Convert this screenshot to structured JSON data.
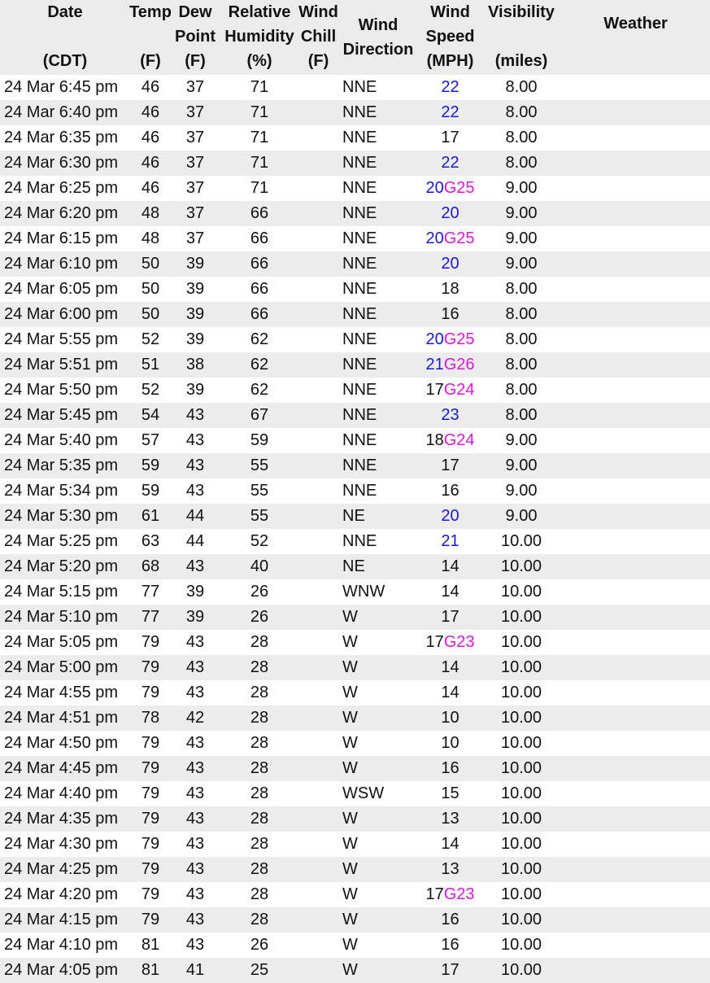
{
  "colors": {
    "sustained_high": "#1a1ad0",
    "gust": "#d61ad6",
    "header_bg": "#ebebeb",
    "row_alt_bg": "#ececec"
  },
  "headers": {
    "date": [
      "Date",
      "",
      "(CDT)"
    ],
    "temp": [
      "Temp",
      "",
      "(F)"
    ],
    "dew": [
      "Dew",
      "Point",
      "(F)"
    ],
    "rh": [
      "Relative",
      "Humidity",
      "(%)"
    ],
    "chill": [
      "Wind",
      "Chill",
      "(F)"
    ],
    "dir": [
      "Wind",
      "Direction"
    ],
    "speed": [
      "Wind",
      "Speed",
      "(MPH)"
    ],
    "vis": [
      "Visibility",
      "",
      "(miles)"
    ],
    "weather": [
      "Weather"
    ]
  },
  "rows": [
    {
      "date": "24 Mar 6:45 pm",
      "temp": "46",
      "dew": "37",
      "rh": "71",
      "chill": "",
      "dir": "NNE",
      "speed": "22",
      "speed_style": "blue",
      "gust": "",
      "vis": "8.00",
      "weather": ""
    },
    {
      "date": "24 Mar 6:40 pm",
      "temp": "46",
      "dew": "37",
      "rh": "71",
      "chill": "",
      "dir": "NNE",
      "speed": "22",
      "speed_style": "blue",
      "gust": "",
      "vis": "8.00",
      "weather": ""
    },
    {
      "date": "24 Mar 6:35 pm",
      "temp": "46",
      "dew": "37",
      "rh": "71",
      "chill": "",
      "dir": "NNE",
      "speed": "17",
      "speed_style": "blk",
      "gust": "",
      "vis": "8.00",
      "weather": ""
    },
    {
      "date": "24 Mar 6:30 pm",
      "temp": "46",
      "dew": "37",
      "rh": "71",
      "chill": "",
      "dir": "NNE",
      "speed": "22",
      "speed_style": "blue",
      "gust": "",
      "vis": "8.00",
      "weather": ""
    },
    {
      "date": "24 Mar 6:25 pm",
      "temp": "46",
      "dew": "37",
      "rh": "71",
      "chill": "",
      "dir": "NNE",
      "speed": "20",
      "speed_style": "blue",
      "gust": "G25",
      "vis": "9.00",
      "weather": ""
    },
    {
      "date": "24 Mar 6:20 pm",
      "temp": "48",
      "dew": "37",
      "rh": "66",
      "chill": "",
      "dir": "NNE",
      "speed": "20",
      "speed_style": "blue",
      "gust": "",
      "vis": "9.00",
      "weather": ""
    },
    {
      "date": "24 Mar 6:15 pm",
      "temp": "48",
      "dew": "37",
      "rh": "66",
      "chill": "",
      "dir": "NNE",
      "speed": "20",
      "speed_style": "blue",
      "gust": "G25",
      "vis": "9.00",
      "weather": ""
    },
    {
      "date": "24 Mar 6:10 pm",
      "temp": "50",
      "dew": "39",
      "rh": "66",
      "chill": "",
      "dir": "NNE",
      "speed": "20",
      "speed_style": "blue",
      "gust": "",
      "vis": "9.00",
      "weather": ""
    },
    {
      "date": "24 Mar 6:05 pm",
      "temp": "50",
      "dew": "39",
      "rh": "66",
      "chill": "",
      "dir": "NNE",
      "speed": "18",
      "speed_style": "blk",
      "gust": "",
      "vis": "8.00",
      "weather": ""
    },
    {
      "date": "24 Mar 6:00 pm",
      "temp": "50",
      "dew": "39",
      "rh": "66",
      "chill": "",
      "dir": "NNE",
      "speed": "16",
      "speed_style": "blk",
      "gust": "",
      "vis": "8.00",
      "weather": ""
    },
    {
      "date": "24 Mar 5:55 pm",
      "temp": "52",
      "dew": "39",
      "rh": "62",
      "chill": "",
      "dir": "NNE",
      "speed": "20",
      "speed_style": "blue",
      "gust": "G25",
      "vis": "8.00",
      "weather": ""
    },
    {
      "date": "24 Mar 5:51 pm",
      "temp": "51",
      "dew": "38",
      "rh": "62",
      "chill": "",
      "dir": "NNE",
      "speed": "21",
      "speed_style": "blue",
      "gust": "G26",
      "vis": "8.00",
      "weather": ""
    },
    {
      "date": "24 Mar 5:50 pm",
      "temp": "52",
      "dew": "39",
      "rh": "62",
      "chill": "",
      "dir": "NNE",
      "speed": "17",
      "speed_style": "blk",
      "gust": "G24",
      "vis": "8.00",
      "weather": ""
    },
    {
      "date": "24 Mar 5:45 pm",
      "temp": "54",
      "dew": "43",
      "rh": "67",
      "chill": "",
      "dir": "NNE",
      "speed": "23",
      "speed_style": "blue",
      "gust": "",
      "vis": "8.00",
      "weather": ""
    },
    {
      "date": "24 Mar 5:40 pm",
      "temp": "57",
      "dew": "43",
      "rh": "59",
      "chill": "",
      "dir": "NNE",
      "speed": "18",
      "speed_style": "blk",
      "gust": "G24",
      "vis": "9.00",
      "weather": ""
    },
    {
      "date": "24 Mar 5:35 pm",
      "temp": "59",
      "dew": "43",
      "rh": "55",
      "chill": "",
      "dir": "NNE",
      "speed": "17",
      "speed_style": "blk",
      "gust": "",
      "vis": "9.00",
      "weather": ""
    },
    {
      "date": "24 Mar 5:34 pm",
      "temp": "59",
      "dew": "43",
      "rh": "55",
      "chill": "",
      "dir": "NNE",
      "speed": "16",
      "speed_style": "blk",
      "gust": "",
      "vis": "9.00",
      "weather": ""
    },
    {
      "date": "24 Mar 5:30 pm",
      "temp": "61",
      "dew": "44",
      "rh": "55",
      "chill": "",
      "dir": "NE",
      "speed": "20",
      "speed_style": "blue",
      "gust": "",
      "vis": "9.00",
      "weather": ""
    },
    {
      "date": "24 Mar 5:25 pm",
      "temp": "63",
      "dew": "44",
      "rh": "52",
      "chill": "",
      "dir": "NNE",
      "speed": "21",
      "speed_style": "blue",
      "gust": "",
      "vis": "10.00",
      "weather": ""
    },
    {
      "date": "24 Mar 5:20 pm",
      "temp": "68",
      "dew": "43",
      "rh": "40",
      "chill": "",
      "dir": "NE",
      "speed": "14",
      "speed_style": "blk",
      "gust": "",
      "vis": "10.00",
      "weather": ""
    },
    {
      "date": "24 Mar 5:15 pm",
      "temp": "77",
      "dew": "39",
      "rh": "26",
      "chill": "",
      "dir": "WNW",
      "speed": "14",
      "speed_style": "blk",
      "gust": "",
      "vis": "10.00",
      "weather": ""
    },
    {
      "date": "24 Mar 5:10 pm",
      "temp": "77",
      "dew": "39",
      "rh": "26",
      "chill": "",
      "dir": "W",
      "speed": "17",
      "speed_style": "blk",
      "gust": "",
      "vis": "10.00",
      "weather": ""
    },
    {
      "date": "24 Mar 5:05 pm",
      "temp": "79",
      "dew": "43",
      "rh": "28",
      "chill": "",
      "dir": "W",
      "speed": "17",
      "speed_style": "blk",
      "gust": "G23",
      "vis": "10.00",
      "weather": ""
    },
    {
      "date": "24 Mar 5:00 pm",
      "temp": "79",
      "dew": "43",
      "rh": "28",
      "chill": "",
      "dir": "W",
      "speed": "14",
      "speed_style": "blk",
      "gust": "",
      "vis": "10.00",
      "weather": ""
    },
    {
      "date": "24 Mar 4:55 pm",
      "temp": "79",
      "dew": "43",
      "rh": "28",
      "chill": "",
      "dir": "W",
      "speed": "14",
      "speed_style": "blk",
      "gust": "",
      "vis": "10.00",
      "weather": ""
    },
    {
      "date": "24 Mar 4:51 pm",
      "temp": "78",
      "dew": "42",
      "rh": "28",
      "chill": "",
      "dir": "W",
      "speed": "10",
      "speed_style": "blk",
      "gust": "",
      "vis": "10.00",
      "weather": ""
    },
    {
      "date": "24 Mar 4:50 pm",
      "temp": "79",
      "dew": "43",
      "rh": "28",
      "chill": "",
      "dir": "W",
      "speed": "10",
      "speed_style": "blk",
      "gust": "",
      "vis": "10.00",
      "weather": ""
    },
    {
      "date": "24 Mar 4:45 pm",
      "temp": "79",
      "dew": "43",
      "rh": "28",
      "chill": "",
      "dir": "W",
      "speed": "16",
      "speed_style": "blk",
      "gust": "",
      "vis": "10.00",
      "weather": ""
    },
    {
      "date": "24 Mar 4:40 pm",
      "temp": "79",
      "dew": "43",
      "rh": "28",
      "chill": "",
      "dir": "WSW",
      "speed": "15",
      "speed_style": "blk",
      "gust": "",
      "vis": "10.00",
      "weather": ""
    },
    {
      "date": "24 Mar 4:35 pm",
      "temp": "79",
      "dew": "43",
      "rh": "28",
      "chill": "",
      "dir": "W",
      "speed": "13",
      "speed_style": "blk",
      "gust": "",
      "vis": "10.00",
      "weather": ""
    },
    {
      "date": "24 Mar 4:30 pm",
      "temp": "79",
      "dew": "43",
      "rh": "28",
      "chill": "",
      "dir": "W",
      "speed": "14",
      "speed_style": "blk",
      "gust": "",
      "vis": "10.00",
      "weather": ""
    },
    {
      "date": "24 Mar 4:25 pm",
      "temp": "79",
      "dew": "43",
      "rh": "28",
      "chill": "",
      "dir": "W",
      "speed": "13",
      "speed_style": "blk",
      "gust": "",
      "vis": "10.00",
      "weather": ""
    },
    {
      "date": "24 Mar 4:20 pm",
      "temp": "79",
      "dew": "43",
      "rh": "28",
      "chill": "",
      "dir": "W",
      "speed": "17",
      "speed_style": "blk",
      "gust": "G23",
      "vis": "10.00",
      "weather": ""
    },
    {
      "date": "24 Mar 4:15 pm",
      "temp": "79",
      "dew": "43",
      "rh": "28",
      "chill": "",
      "dir": "W",
      "speed": "16",
      "speed_style": "blk",
      "gust": "",
      "vis": "10.00",
      "weather": ""
    },
    {
      "date": "24 Mar 4:10 pm",
      "temp": "81",
      "dew": "43",
      "rh": "26",
      "chill": "",
      "dir": "W",
      "speed": "16",
      "speed_style": "blk",
      "gust": "",
      "vis": "10.00",
      "weather": ""
    },
    {
      "date": "24 Mar 4:05 pm",
      "temp": "81",
      "dew": "41",
      "rh": "25",
      "chill": "",
      "dir": "W",
      "speed": "17",
      "speed_style": "blk",
      "gust": "",
      "vis": "10.00",
      "weather": ""
    }
  ]
}
